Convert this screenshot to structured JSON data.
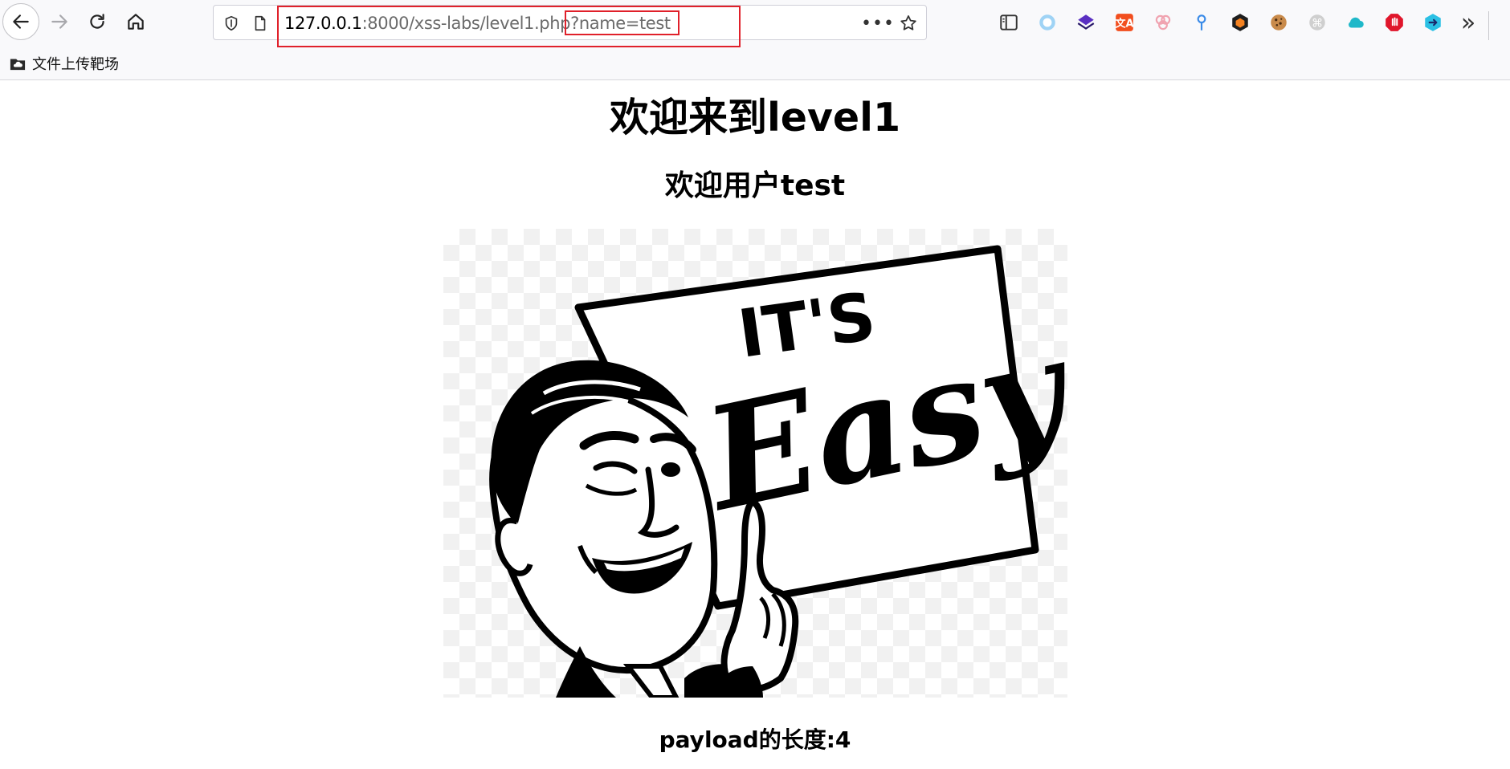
{
  "browser": {
    "url": {
      "host": "127.0.0.1",
      "path": ":8000/xss-labs/level1.php?",
      "query": "name=test"
    },
    "more_glyph": "•••",
    "overflow_glyph": "»",
    "toolbar_icons": [
      "sidebar-icon",
      "circle-extension-icon",
      "layers-extension-icon",
      "translate-extension-icon",
      "flower-extension-icon",
      "pin-extension-icon",
      "shield-extension-icon",
      "cookie-extension-icon",
      "command-extension-icon",
      "cloud-extension-icon",
      "stop-hand-extension-icon",
      "arrow-extension-icon"
    ],
    "bookmarks": [
      {
        "label": "文件上传靶场",
        "icon": "cloud-folder-icon"
      }
    ],
    "highlight_color": "#e0202a"
  },
  "page": {
    "title": "欢迎来到level1",
    "welcome": "欢迎用户test",
    "image": {
      "sign_line1": "IT'S",
      "sign_line2": "Easy"
    },
    "payload_length": "payload的长度:4"
  }
}
